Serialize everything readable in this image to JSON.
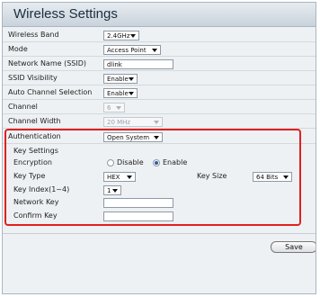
{
  "title": "Wireless Settings",
  "fields": {
    "wireless_band": {
      "label": "Wireless Band",
      "value": "2.4GHz"
    },
    "mode": {
      "label": "Mode",
      "value": "Access Point"
    },
    "ssid": {
      "label": "Network Name (SSID)",
      "value": "dlink"
    },
    "ssid_visibility": {
      "label": "SSID Visibility",
      "value": "Enable"
    },
    "auto_channel": {
      "label": "Auto Channel Selection",
      "value": "Enable"
    },
    "channel": {
      "label": "Channel",
      "value": "6"
    },
    "channel_width": {
      "label": "Channel Width",
      "value": "20 MHz"
    },
    "authentication": {
      "label": "Authentication",
      "value": "Open System"
    }
  },
  "key_settings": {
    "heading": "Key Settings",
    "encryption_label": "Encryption",
    "disable_label": "Disable",
    "enable_label": "Enable",
    "encryption_selected": "Enable",
    "key_type_label": "Key Type",
    "key_type_value": "HEX",
    "key_size_label": "Key Size",
    "key_size_value": "64 Bits",
    "key_index_label": "Key Index(1~4)",
    "key_index_value": "1",
    "network_key_label": "Network Key",
    "network_key_value": "",
    "confirm_key_label": "Confirm Key",
    "confirm_key_value": ""
  },
  "save_label": "Save",
  "colors": {
    "highlight_border": "#e02020",
    "panel_bg": "#eef1f3",
    "title_text": "#1a2d3f"
  }
}
